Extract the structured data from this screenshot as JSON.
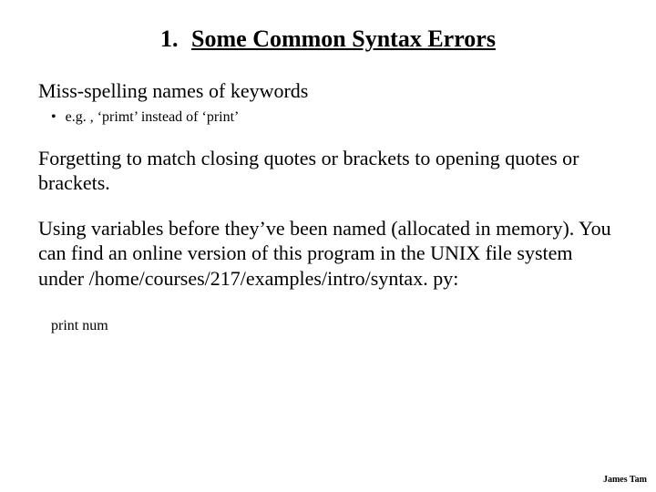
{
  "heading": {
    "number": "1.",
    "title": "Some Common Syntax Errors"
  },
  "para1": "Miss-spelling names of keywords",
  "bullet1": "e.g. , ‘primt’ instead of ‘print’",
  "para2": "Forgetting to match closing quotes or brackets to opening quotes or brackets.",
  "para3": "Using variables before they’ve been named (allocated in memory). You can find an online version of this program in the UNIX file system under /home/courses/217/examples/intro/syntax. py:",
  "code": "print num",
  "footer": "James Tam"
}
